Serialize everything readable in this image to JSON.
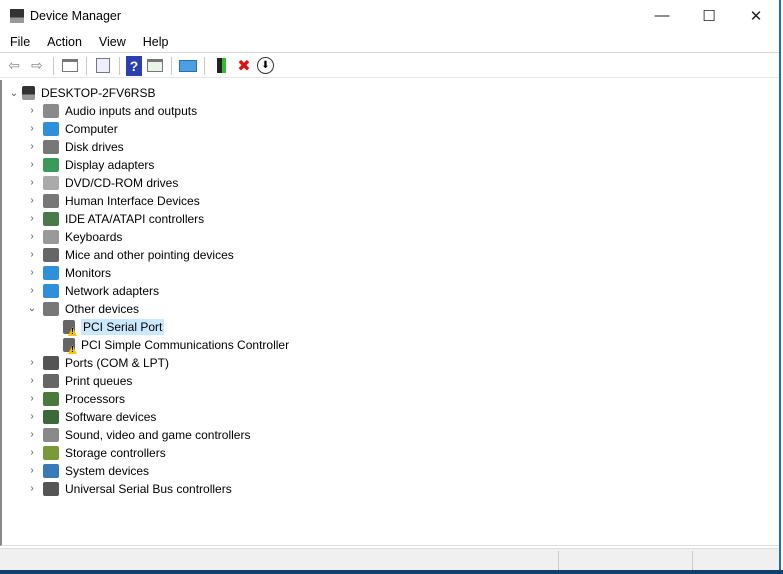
{
  "window": {
    "title": "Device Manager",
    "minimize": "—",
    "maximize": "☐",
    "close": "✕"
  },
  "menu": [
    "File",
    "Action",
    "View",
    "Help"
  ],
  "toolbar": {
    "back": "⇦",
    "forward": "⇨",
    "help": "?",
    "remove": "✖",
    "update": "⬇"
  },
  "tree": {
    "root": "DESKTOP-2FV6RSB",
    "categories": [
      {
        "label": "Audio inputs and outputs",
        "color": "#8a8a8a"
      },
      {
        "label": "Computer",
        "color": "#2f8fd8"
      },
      {
        "label": "Disk drives",
        "color": "#777"
      },
      {
        "label": "Display adapters",
        "color": "#3a9a5a"
      },
      {
        "label": "DVD/CD-ROM drives",
        "color": "#aaa"
      },
      {
        "label": "Human Interface Devices",
        "color": "#777"
      },
      {
        "label": "IDE ATA/ATAPI controllers",
        "color": "#4a7a4a"
      },
      {
        "label": "Keyboards",
        "color": "#999"
      },
      {
        "label": "Mice and other pointing devices",
        "color": "#666"
      },
      {
        "label": "Monitors",
        "color": "#2f8fd8"
      },
      {
        "label": "Network adapters",
        "color": "#2f8fd8"
      },
      {
        "label": "Other devices",
        "color": "#777",
        "expanded": true,
        "children": [
          "PCI Serial Port",
          "PCI Simple Communications Controller"
        ]
      },
      {
        "label": "Ports (COM & LPT)",
        "color": "#555"
      },
      {
        "label": "Print queues",
        "color": "#666"
      },
      {
        "label": "Processors",
        "color": "#4a7a3a"
      },
      {
        "label": "Software devices",
        "color": "#3a6a3a"
      },
      {
        "label": "Sound, video and game controllers",
        "color": "#8a8a8a"
      },
      {
        "label": "Storage controllers",
        "color": "#7a9a3a"
      },
      {
        "label": "System devices",
        "color": "#3a7ab8"
      },
      {
        "label": "Universal Serial Bus controllers",
        "color": "#555"
      }
    ]
  }
}
